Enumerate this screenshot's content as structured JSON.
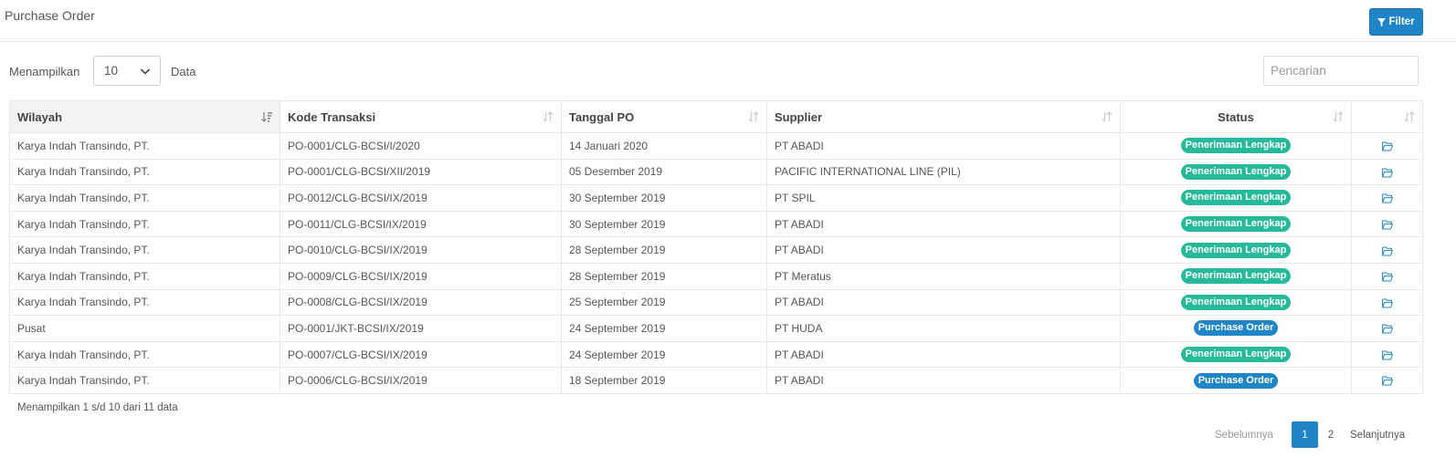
{
  "page": {
    "title": "Purchase Order",
    "filter_label": "Filter"
  },
  "length": {
    "label_prefix": "Menampilkan",
    "value": "10",
    "label_suffix": "Data"
  },
  "search": {
    "placeholder": "Pencarian"
  },
  "table": {
    "columns": [
      "Wilayah",
      "Kode Transaksi",
      "Tanggal PO",
      "Supplier",
      "Status",
      ""
    ],
    "rows": [
      {
        "wilayah": "Karya Indah Transindo, PT.",
        "kode": "PO-0001/CLG-BCSI/I/2020",
        "tanggal": "14 Januari 2020",
        "supplier": "PT ABADI",
        "status": "Penerimaan Lengkap",
        "status_type": "green"
      },
      {
        "wilayah": "Karya Indah Transindo, PT.",
        "kode": "PO-0001/CLG-BCSI/XII/2019",
        "tanggal": "05 Desember 2019",
        "supplier": "PACIFIC INTERNATIONAL LINE (PIL)",
        "status": "Penerimaan Lengkap",
        "status_type": "green"
      },
      {
        "wilayah": "Karya Indah Transindo, PT.",
        "kode": "PO-0012/CLG-BCSI/IX/2019",
        "tanggal": "30 September 2019",
        "supplier": "PT SPIL",
        "status": "Penerimaan Lengkap",
        "status_type": "green"
      },
      {
        "wilayah": "Karya Indah Transindo, PT.",
        "kode": "PO-0011/CLG-BCSI/IX/2019",
        "tanggal": "30 September 2019",
        "supplier": "PT ABADI",
        "status": "Penerimaan Lengkap",
        "status_type": "green"
      },
      {
        "wilayah": "Karya Indah Transindo, PT.",
        "kode": "PO-0010/CLG-BCSI/IX/2019",
        "tanggal": "28 September 2019",
        "supplier": "PT ABADI",
        "status": "Penerimaan Lengkap",
        "status_type": "green"
      },
      {
        "wilayah": "Karya Indah Transindo, PT.",
        "kode": "PO-0009/CLG-BCSI/IX/2019",
        "tanggal": "28 September 2019",
        "supplier": "PT Meratus",
        "status": "Penerimaan Lengkap",
        "status_type": "green"
      },
      {
        "wilayah": "Karya Indah Transindo, PT.",
        "kode": "PO-0008/CLG-BCSI/IX/2019",
        "tanggal": "25 September 2019",
        "supplier": "PT ABADI",
        "status": "Penerimaan Lengkap",
        "status_type": "green"
      },
      {
        "wilayah": "Pusat",
        "kode": "PO-0001/JKT-BCSI/IX/2019",
        "tanggal": "24 September 2019",
        "supplier": "PT HUDA",
        "status": "Purchase Order",
        "status_type": "blue"
      },
      {
        "wilayah": "Karya Indah Transindo, PT.",
        "kode": "PO-0007/CLG-BCSI/IX/2019",
        "tanggal": "24 September 2019",
        "supplier": "PT ABADI",
        "status": "Penerimaan Lengkap",
        "status_type": "green"
      },
      {
        "wilayah": "Karya Indah Transindo, PT.",
        "kode": "PO-0006/CLG-BCSI/IX/2019",
        "tanggal": "18 September 2019",
        "supplier": "PT ABADI",
        "status": "Purchase Order",
        "status_type": "blue"
      }
    ]
  },
  "info": "Menampilkan 1 s/d 10 dari 11 data",
  "pagination": {
    "prev": "Sebelumnya",
    "pages": [
      "1",
      "2"
    ],
    "next": "Selanjutnya"
  },
  "icons": {
    "filter": "filter-icon",
    "select": "chevron-down-icon",
    "sort": "sort-icon",
    "sort_active": "sort-asc-icon",
    "open": "folder-open-icon"
  },
  "colors": {
    "primary": "#1f85c7",
    "success": "#26b99a"
  }
}
